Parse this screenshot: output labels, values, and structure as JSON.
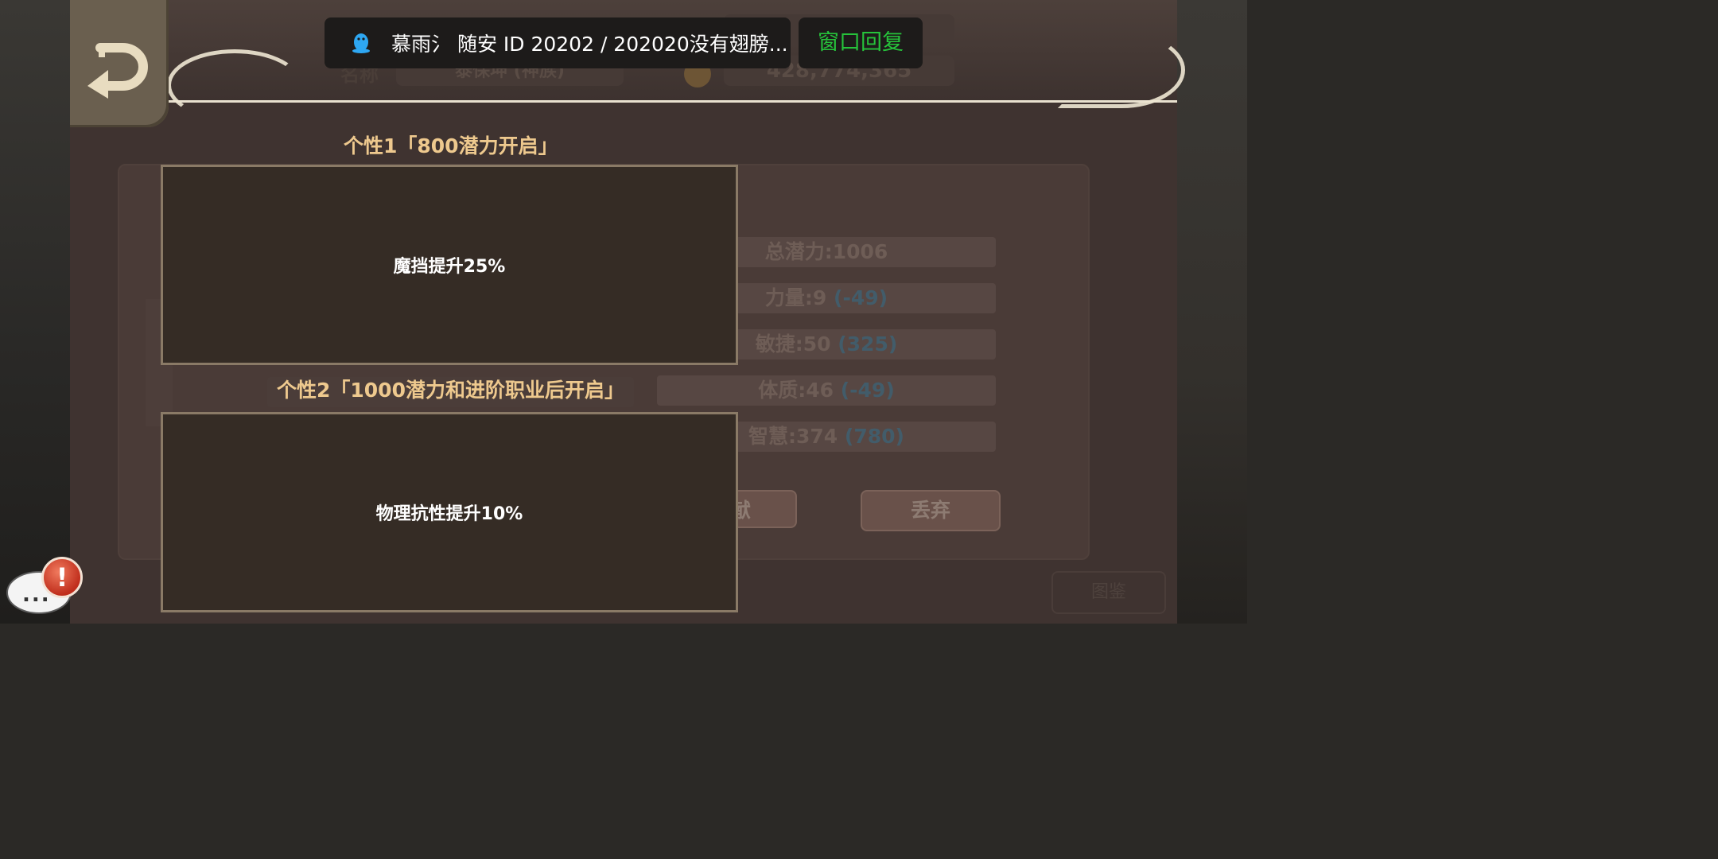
{
  "notification": {
    "text": "慕雨氵 随安 ID 20202 / 202020没有翅膀...",
    "restore_label": "窗口回复"
  },
  "header": {
    "name_label": "名称",
    "name_value": "泰保坤 (神族)",
    "gold_value": "428,774,365"
  },
  "traits": [
    {
      "title": "个性1「800潜力开启」",
      "effect": "魔挡提升25%"
    },
    {
      "title": "个性2「1000潜力和进阶职业后开启」",
      "effect": "物理抗性提升10%"
    }
  ],
  "stats": [
    {
      "label": "总潜力:1006",
      "delta": ""
    },
    {
      "label": "力量:9",
      "delta": "(-49)"
    },
    {
      "label": "敏捷:50",
      "delta": "(325)"
    },
    {
      "label": "体质:46",
      "delta": "(-49)"
    },
    {
      "label": "智慧:374",
      "delta": "(780)"
    }
  ],
  "buttons": {
    "contribute_partial": "献",
    "discard": "丢弃",
    "codex": "图鉴"
  },
  "chat": {
    "dots": "..."
  },
  "alert": {
    "mark": "!"
  }
}
